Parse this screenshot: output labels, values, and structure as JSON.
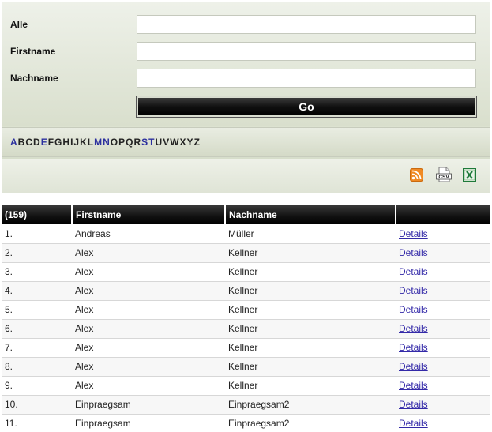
{
  "search": {
    "fields": [
      {
        "label": "Alle",
        "value": ""
      },
      {
        "label": "Firstname",
        "value": ""
      },
      {
        "label": "Nachname",
        "value": ""
      }
    ],
    "go_label": "Go"
  },
  "alphabet": {
    "letters": [
      "A",
      "B",
      "C",
      "D",
      "E",
      "F",
      "G",
      "H",
      "I",
      "J",
      "K",
      "L",
      "M",
      "N",
      "O",
      "P",
      "Q",
      "R",
      "S",
      "T",
      "U",
      "V",
      "W",
      "X",
      "Y",
      "Z"
    ],
    "highlighted": [
      "A",
      "E",
      "M",
      "N",
      "S",
      "T"
    ],
    "highlight_color": "#2b2f9e"
  },
  "exports": [
    {
      "name": "rss-icon",
      "label": ""
    },
    {
      "name": "csv-icon",
      "label": "CSV"
    },
    {
      "name": "excel-icon",
      "label": ""
    }
  ],
  "table": {
    "headers": [
      "(159)",
      "Firstname",
      "Nachname",
      ""
    ],
    "rows": [
      {
        "no": "1.",
        "first": "Andreas",
        "last": "Müller",
        "link": "Details"
      },
      {
        "no": "2.",
        "first": "Alex",
        "last": "Kellner",
        "link": "Details"
      },
      {
        "no": "3.",
        "first": "Alex",
        "last": "Kellner",
        "link": "Details"
      },
      {
        "no": "4.",
        "first": "Alex",
        "last": "Kellner",
        "link": "Details"
      },
      {
        "no": "5.",
        "first": "Alex",
        "last": "Kellner",
        "link": "Details"
      },
      {
        "no": "6.",
        "first": "Alex",
        "last": "Kellner",
        "link": "Details"
      },
      {
        "no": "7.",
        "first": "Alex",
        "last": "Kellner",
        "link": "Details"
      },
      {
        "no": "8.",
        "first": "Alex",
        "last": "Kellner",
        "link": "Details"
      },
      {
        "no": "9.",
        "first": "Alex",
        "last": "Kellner",
        "link": "Details"
      },
      {
        "no": "10.",
        "first": "Einpraegsam",
        "last": "Einpraegsam2",
        "link": "Details"
      },
      {
        "no": "11.",
        "first": "Einpraegsam",
        "last": "Einpraegsam2",
        "link": "Details"
      }
    ]
  }
}
